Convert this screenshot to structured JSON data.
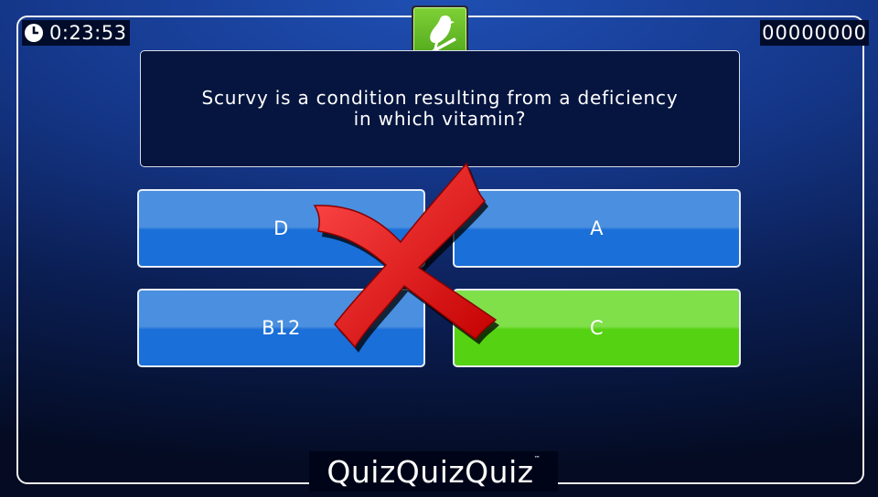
{
  "hud": {
    "timer": "0:23:53",
    "score": "00000000",
    "clock_icon": "clock-icon",
    "badge_icon": "bird-icon"
  },
  "question": {
    "text": "Scurvy is a condition resulting from a deficiency in which vitamin?"
  },
  "answers": [
    {
      "label": "D",
      "state": "normal"
    },
    {
      "label": "A",
      "state": "normal"
    },
    {
      "label": "B12",
      "state": "normal"
    },
    {
      "label": "C",
      "state": "correct"
    }
  ],
  "feedback": {
    "icon": "wrong-x-icon",
    "result": "incorrect"
  },
  "branding": {
    "logo": "QuizQuizQuiz",
    "trademark": "™"
  },
  "colors": {
    "answer_blue": "#1a6fd8",
    "answer_correct_green": "#55d212",
    "wrong_mark_red": "#e01010",
    "badge_green": "#5cb423"
  }
}
